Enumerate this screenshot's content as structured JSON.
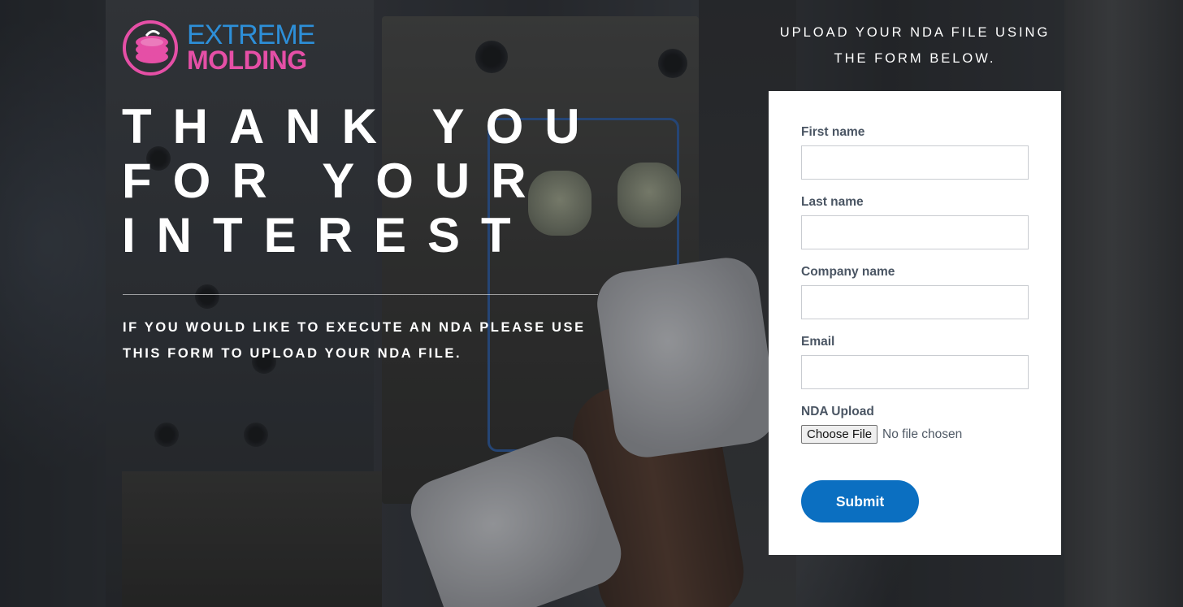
{
  "brand": {
    "name_line1": "EXTREME",
    "name_line2": "MOLDING",
    "colors": {
      "blue": "#2d8fd8",
      "pink": "#e54fa6"
    },
    "icon": "extreme-molding-logo-mark"
  },
  "hero": {
    "title": "THANK YOU\nFOR YOUR\nINTEREST",
    "subtitle": "IF YOU WOULD LIKE TO EXECUTE AN NDA PLEASE USE THIS FORM TO UPLOAD YOUR NDA FILE."
  },
  "upload_section": {
    "heading": "UPLOAD YOUR NDA FILE USING THE FORM BELOW."
  },
  "form": {
    "fields": [
      {
        "label": "First name",
        "value": ""
      },
      {
        "label": "Last name",
        "value": ""
      },
      {
        "label": "Company name",
        "value": ""
      },
      {
        "label": "Email",
        "value": ""
      }
    ],
    "upload": {
      "label": "NDA Upload",
      "button_label": "Choose File",
      "status": "No file chosen"
    },
    "submit_label": "Submit",
    "submit_color": "#0b6fc1"
  }
}
